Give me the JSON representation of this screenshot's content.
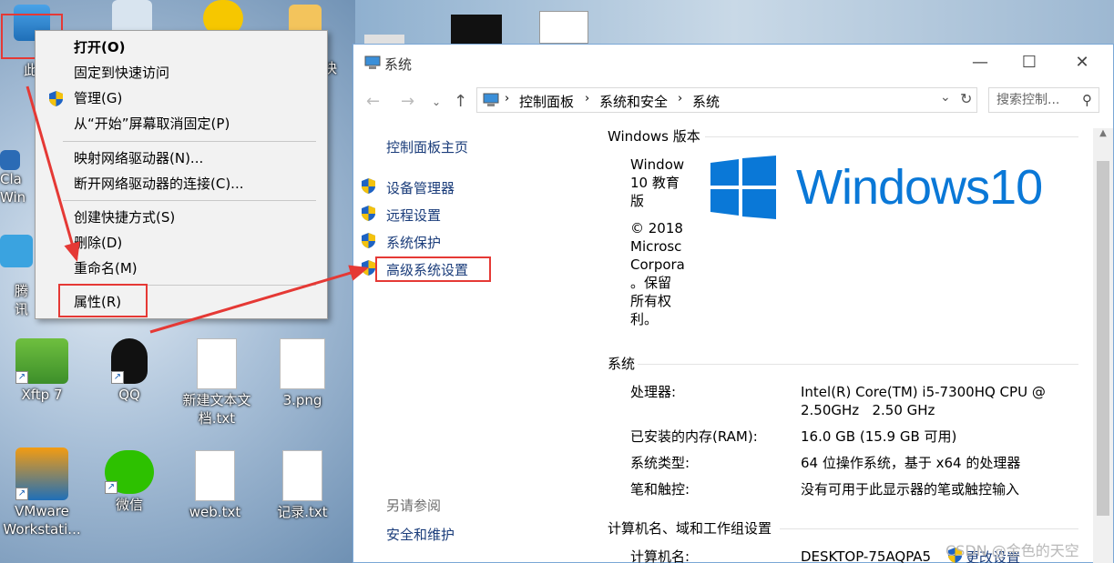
{
  "desktop": {
    "icons": [
      {
        "label": "此"
      },
      {
        "label": ""
      },
      {
        "label": ""
      },
      {
        "label": "快"
      },
      {
        "label": "Cla Win"
      },
      {
        "label": "腾讯"
      },
      {
        "label": "Xftp 7"
      },
      {
        "label": "QQ"
      },
      {
        "label": "新建文本文档.txt"
      },
      {
        "label": "3.png"
      },
      {
        "label": "VMware Workstati..."
      },
      {
        "label": "微信"
      },
      {
        "label": "web.txt"
      },
      {
        "label": "记录.txt"
      }
    ]
  },
  "context_menu": {
    "items": [
      "打开(O)",
      "固定到快速访问",
      "管理(G)",
      "从“开始”屏幕取消固定(P)",
      "映射网络驱动器(N)...",
      "断开网络驱动器的连接(C)...",
      "创建快捷方式(S)",
      "删除(D)",
      "重命名(M)",
      "属性(R)"
    ]
  },
  "window": {
    "title": "系统",
    "breadcrumb": [
      "控制面板",
      "系统和安全",
      "系统"
    ],
    "search_placeholder": "搜索控制...",
    "sidebar": {
      "home": "控制面板主页",
      "links": [
        "设备管理器",
        "远程设置",
        "系统保护",
        "高级系统设置"
      ],
      "see_also": "另请参阅",
      "see_also_link": "安全和维护"
    },
    "edition": {
      "heading": "Windows 版本",
      "lines": [
        "Window",
        "10 教育",
        "版",
        "© 2018",
        "Microsc",
        "Corpora",
        "。保留",
        "所有权",
        "利。"
      ],
      "logo_text": "Windows10"
    },
    "system": {
      "heading": "系统",
      "rows": [
        {
          "label": "处理器:",
          "value": "Intel(R) Core(TM) i5-7300HQ CPU @",
          "value2": "2.50GHz   2.50 GHz"
        },
        {
          "label": "已安装的内存(RAM):",
          "value": "16.0 GB (15.9 GB 可用)"
        },
        {
          "label": "系统类型:",
          "value": "64 位操作系统，基于 x64 的处理器"
        },
        {
          "label": "笔和触控:",
          "value": "没有可用于此显示器的笔或触控输入"
        }
      ]
    },
    "computer": {
      "heading": "计算机名、域和工作组设置",
      "name_label": "计算机名:",
      "name_value": "DESKTOP-75AQPA5",
      "change": "更改设置"
    }
  },
  "watermark": "CSDN @金色的天空"
}
